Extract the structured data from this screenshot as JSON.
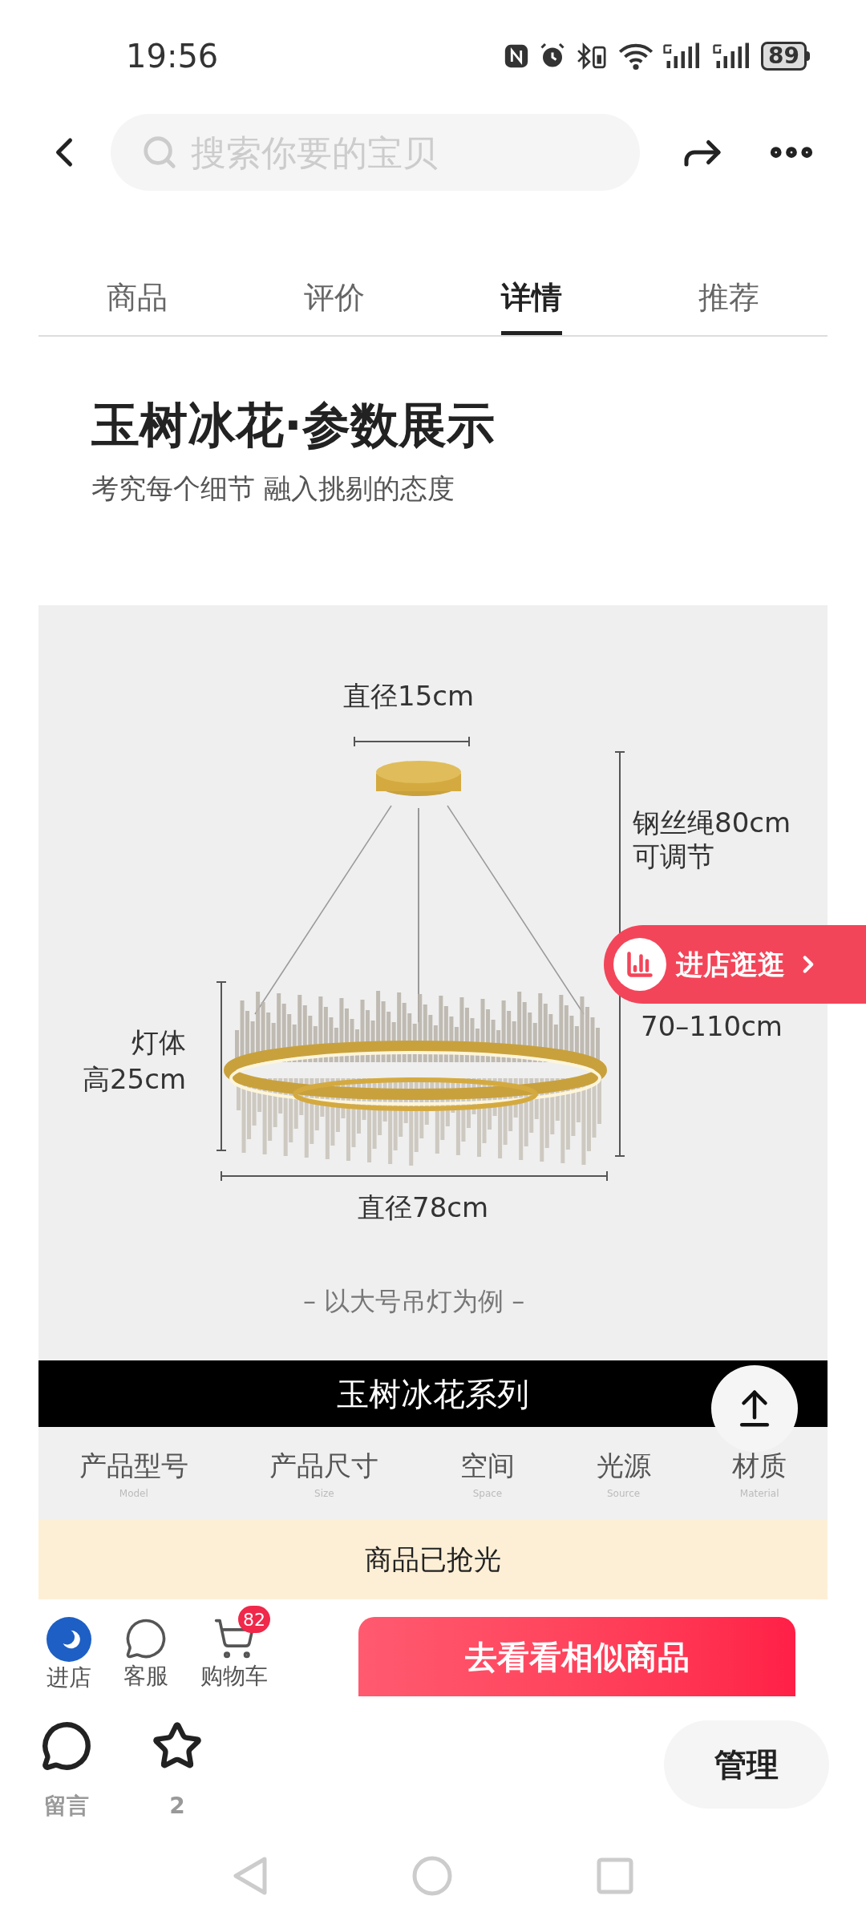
{
  "status_bar": {
    "time": "19:56",
    "battery": "89"
  },
  "header": {
    "search": {
      "placeholder": "搜索你要的宝贝"
    }
  },
  "tabs": [
    {
      "label": "商品",
      "selected": false
    },
    {
      "label": "评价",
      "selected": false
    },
    {
      "label": "详情",
      "selected": true
    },
    {
      "label": "推荐",
      "selected": false
    }
  ],
  "detail": {
    "title": "玉树冰花·参数展示",
    "subtitle": "考究每个细节 融入挑剔的态度",
    "diagram": {
      "top_diameter": "直径15cm",
      "cable": [
        "钢丝绳80cm",
        "可调节"
      ],
      "height_range": "70–110cm",
      "body_height": [
        "灯体",
        "高25cm"
      ],
      "bottom_diameter": "直径78cm",
      "note": "– 以大号吊灯为例 –"
    },
    "series_banner": "玉树冰花系列",
    "params": [
      {
        "label": "产品型号",
        "sublabel": "Model"
      },
      {
        "label": "产品尺寸",
        "sublabel": "Size"
      },
      {
        "label": "空间",
        "sublabel": "Space"
      },
      {
        "label": "光源",
        "sublabel": "Source"
      },
      {
        "label": "材质",
        "sublabel": "Material"
      }
    ]
  },
  "store_button": {
    "label": "进店逛逛"
  },
  "sold_out": "商品已抢光",
  "action_bar": {
    "items": [
      {
        "kind": "store",
        "label": "进店"
      },
      {
        "kind": "service",
        "label": "客服"
      },
      {
        "kind": "cart",
        "label": "购物车",
        "badge": "82"
      }
    ],
    "primary_button": "去看看相似商品"
  },
  "bottom_bar": {
    "comment": "留言",
    "favorites": "2",
    "manage": "管理"
  }
}
